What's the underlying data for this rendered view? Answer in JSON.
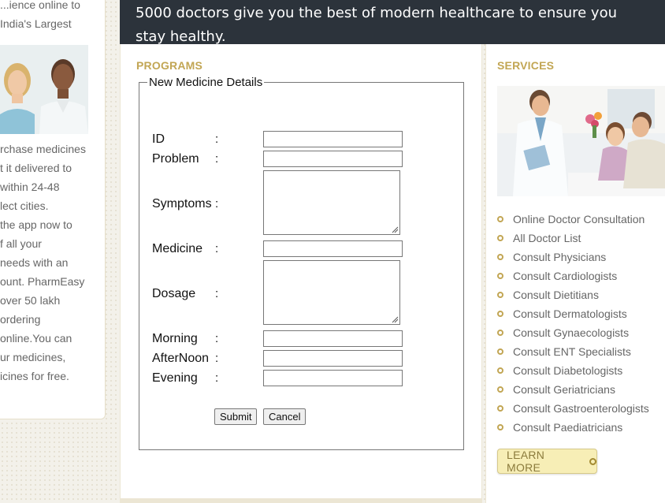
{
  "left": {
    "top_text": [
      "...ience online to",
      "India's Largest"
    ],
    "body_lines": [
      "rchase medicines",
      "t it delivered to",
      "within 24-48",
      "lect cities.",
      "the app now to",
      "f all your",
      "needs with an",
      "ount. PharmEasy",
      "over 50 lakh",
      "ordering",
      "online.You can",
      "ur medicines,",
      "icines for free."
    ]
  },
  "banner": {
    "text": "5000 doctors give you the best of modern healthcare to ensure you stay healthy."
  },
  "programs": {
    "title": "PROGRAMS",
    "form": {
      "legend": "New Medicine Details",
      "fields": {
        "id": {
          "label": "ID",
          "colon": ":",
          "value": ""
        },
        "problem": {
          "label": "Problem",
          "colon": ":",
          "value": ""
        },
        "symptoms": {
          "label": "Symptoms",
          "colon": ":",
          "value": ""
        },
        "medicine": {
          "label": "Medicine",
          "colon": ":",
          "value": ""
        },
        "dosage": {
          "label": "Dosage",
          "colon": ":",
          "value": ""
        },
        "morning": {
          "label": "Morning",
          "colon": ":",
          "value": ""
        },
        "afternoon": {
          "label": "AfterNoon",
          "colon": ":",
          "value": ""
        },
        "evening": {
          "label": "Evening",
          "colon": ":",
          "value": ""
        }
      },
      "submit_label": "Submit",
      "cancel_label": "Cancel"
    }
  },
  "services": {
    "title": "SERVICES",
    "items": [
      "Online Doctor Consultation",
      "All Doctor List",
      "Consult Physicians",
      "Consult Cardiologists",
      "Consult Dietitians",
      "Consult Dermatologists",
      "Consult Gynaecologists",
      "Consult ENT Specialists",
      "Consult Diabetologists",
      "Consult Geriatricians",
      "Consult Gastroenterologists",
      "Consult Paediatricians"
    ],
    "learn_more_label": "LEARN MORE"
  },
  "colors": {
    "banner_bg": "#2c333b",
    "accent_gold": "#c2a654",
    "learn_more_bg": "#f7eeb6"
  }
}
